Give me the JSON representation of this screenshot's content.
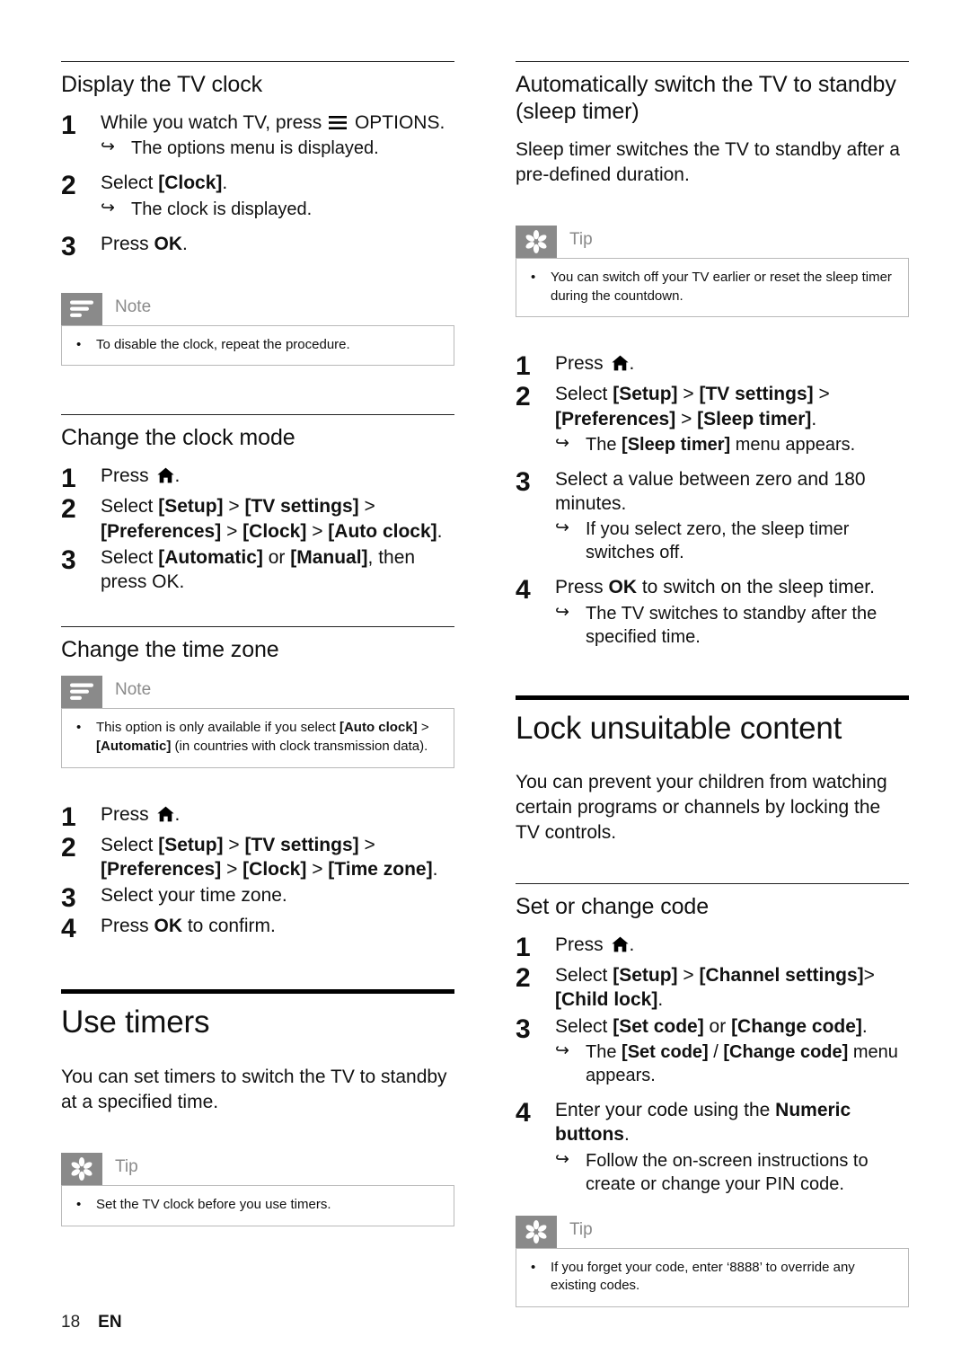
{
  "page": {
    "number": "18",
    "language": "EN"
  },
  "icons": {
    "note": "note-lines-icon",
    "tip": "tip-asterisk-icon",
    "options": "options-menu-icon",
    "home": "home-icon",
    "result_arrow": "result-arrow-icon",
    "bullet": "bullet-icon"
  },
  "labels": {
    "note": "Note",
    "tip": "Tip",
    "arrow": "↪",
    "bullet": "•"
  },
  "left_column": {
    "section_display_clock": {
      "heading": "Display the TV clock",
      "steps": [
        {
          "num": "1",
          "text_before_icon": "While you watch TV, press ",
          "icon": "options-menu-icon",
          "text_after_icon": " OPTIONS.",
          "result": "The options menu is displayed."
        },
        {
          "num": "2",
          "text": "Select [Clock].",
          "result": "The clock is displayed."
        },
        {
          "num": "3",
          "text": "Press OK."
        }
      ],
      "note": {
        "label": "Note",
        "items": [
          "To disable the clock, repeat the procedure."
        ]
      }
    },
    "section_clock_mode": {
      "heading": "Change the clock mode",
      "steps": [
        {
          "num": "1",
          "text_before_icon": "Press ",
          "icon": "home-icon",
          "text_after_icon": "."
        },
        {
          "num": "2",
          "text": "Select [Setup] > [TV settings] > [Preferences] > [Clock] > [Auto clock]."
        },
        {
          "num": "3",
          "text": "Select [Automatic] or [Manual], then press OK."
        }
      ]
    },
    "section_time_zone": {
      "heading": "Change the time zone",
      "note": {
        "label": "Note",
        "items": [
          "This option is only available if you select [Auto clock] > [Automatic] (in countries with clock transmission data)."
        ]
      },
      "steps": [
        {
          "num": "1",
          "text_before_icon": "Press ",
          "icon": "home-icon",
          "text_after_icon": "."
        },
        {
          "num": "2",
          "text": "Select [Setup] > [TV settings] > [Preferences] > [Clock] > [Time zone]."
        },
        {
          "num": "3",
          "text": "Select your time zone."
        },
        {
          "num": "4",
          "text": "Press OK to confirm."
        }
      ]
    },
    "section_use_timers": {
      "heading": "Use timers",
      "intro": "You can set timers to switch the TV to standby at a specified time.",
      "tip": {
        "label": "Tip",
        "items": [
          "Set the TV clock before you use timers."
        ]
      }
    }
  },
  "right_column": {
    "section_sleep_timer": {
      "heading": "Automatically switch the TV to standby (sleep timer)",
      "intro": "Sleep timer switches the TV to standby after a pre-defined duration.",
      "tip": {
        "label": "Tip",
        "items": [
          "You can switch off your TV earlier or reset the sleep timer during the countdown."
        ]
      },
      "steps": [
        {
          "num": "1",
          "text_before_icon": "Press ",
          "icon": "home-icon",
          "text_after_icon": "."
        },
        {
          "num": "2",
          "text": "Select [Setup] > [TV settings] > [Preferences] > [Sleep timer].",
          "result": "The [Sleep timer] menu appears."
        },
        {
          "num": "3",
          "text": "Select a value between zero and 180 minutes.",
          "result": "If you select zero, the sleep timer switches off."
        },
        {
          "num": "4",
          "text": "Press OK to switch on the sleep timer.",
          "result": "The TV switches to standby after the specified time."
        }
      ]
    },
    "section_lock_content": {
      "heading": "Lock unsuitable content",
      "intro": "You can prevent your children from watching certain programs or channels by locking the TV controls."
    },
    "section_set_code": {
      "heading": "Set or change code",
      "steps": [
        {
          "num": "1",
          "text_before_icon": "Press ",
          "icon": "home-icon",
          "text_after_icon": "."
        },
        {
          "num": "2",
          "text": "Select [Setup] > [Channel settings]>[Child lock]."
        },
        {
          "num": "3",
          "text": "Select [Set code] or [Change code].",
          "result": "The [Set code] / [Change code] menu appears."
        },
        {
          "num": "4",
          "text": "Enter your code using the Numeric buttons.",
          "result": "Follow the on-screen instructions to create or change your PIN code."
        }
      ],
      "tip": {
        "label": "Tip",
        "items": [
          "If you forget your code, enter ‘8888’ to override any existing codes."
        ]
      }
    }
  },
  "colors": {
    "callout_icon_bg": "#8a8a8a",
    "callout_label": "#8a8a8a",
    "callout_border": "#b9b9b9",
    "text": "#111111"
  }
}
